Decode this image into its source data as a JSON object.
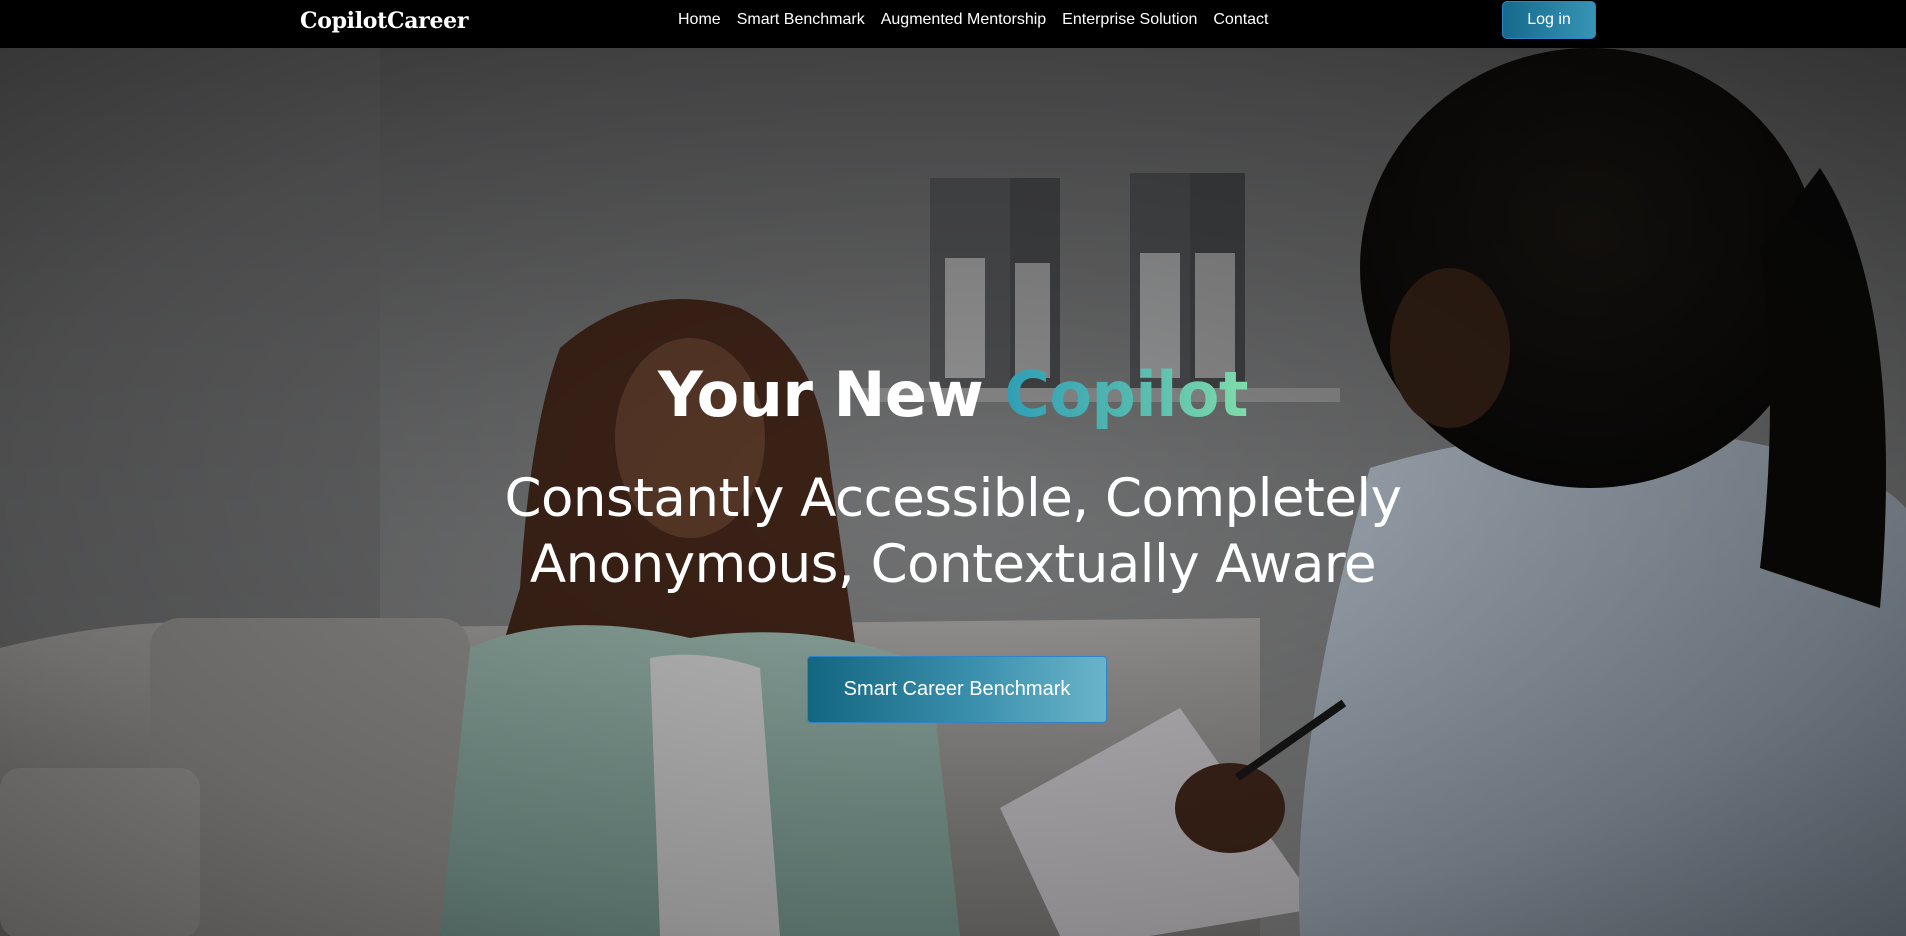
{
  "navbar": {
    "brand": "CopilotCareer",
    "links": [
      {
        "label": "Home"
      },
      {
        "label": "Smart Benchmark"
      },
      {
        "label": "Augmented Mentorship"
      },
      {
        "label": "Enterprise Solution"
      },
      {
        "label": "Contact"
      }
    ],
    "login_label": "Log in"
  },
  "hero": {
    "title_prefix": "Your New ",
    "title_accent": "Copilot",
    "subtitle_line1": "Constantly Accessible, Completely",
    "subtitle_line2": "Anonymous, Contextually Aware",
    "cta_label": "Smart Career Benchmark"
  },
  "colors": {
    "navbar_bg": "#000000",
    "accent_start": "#2f9fb5",
    "accent_end": "#7fdcaa",
    "button_start": "#166a8c",
    "button_end": "#6ab4c9"
  }
}
